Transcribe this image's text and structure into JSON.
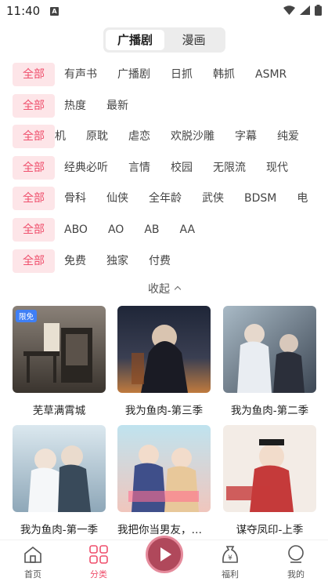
{
  "status_bar": {
    "time": "11:40",
    "notif_icon": "A"
  },
  "toggle": {
    "items": [
      "广播剧",
      "漫画"
    ],
    "active": 0
  },
  "filters": [
    {
      "all": "全部",
      "options": [
        "有声书",
        "广播剧",
        "日抓",
        "韩抓",
        "ASMR"
      ]
    },
    {
      "all": "全部",
      "options": [
        "热度",
        "最新"
      ]
    },
    {
      "all": "全部",
      "options": [
        "机",
        "原耽",
        "虐恋",
        "欢脱沙雕",
        "字幕",
        "纯爱"
      ]
    },
    {
      "all": "全部",
      "options": [
        "经典必听",
        "言情",
        "校园",
        "无限流",
        "现代"
      ]
    },
    {
      "all": "全部",
      "options": [
        "骨科",
        "仙侠",
        "全年龄",
        "武侠",
        "BDSM",
        "电"
      ]
    },
    {
      "all": "全部",
      "options": [
        "ABO",
        "AO",
        "AB",
        "AA"
      ]
    },
    {
      "all": "全部",
      "options": [
        "免费",
        "独家",
        "付费"
      ]
    }
  ],
  "collapse_label": "收起",
  "cards": [
    {
      "title": "芜草满霄城",
      "badge": "限免",
      "colors": [
        "#6b6259",
        "#2e2a26"
      ]
    },
    {
      "title": "我为鱼肉-第三季",
      "badge": "",
      "colors": [
        "#2b3347",
        "#b86a3a"
      ]
    },
    {
      "title": "我为鱼肉-第二季",
      "badge": "",
      "colors": [
        "#8fa3b3",
        "#3d4754"
      ]
    },
    {
      "title": "我为鱼肉-第一季",
      "badge": "",
      "colors": [
        "#cfe0ea",
        "#6d8aa0"
      ]
    },
    {
      "title": "我把你当男友，你…",
      "badge": "",
      "colors": [
        "#a8d6e8",
        "#e8b6b0"
      ]
    },
    {
      "title": "谋夺凤印-上季",
      "badge": "",
      "colors": [
        "#f3ece6",
        "#c53a3a"
      ]
    }
  ],
  "nav": {
    "home": "首页",
    "category": "分类",
    "welfare": "福利",
    "mine": "我的",
    "active_color": "#ef4f6c"
  }
}
